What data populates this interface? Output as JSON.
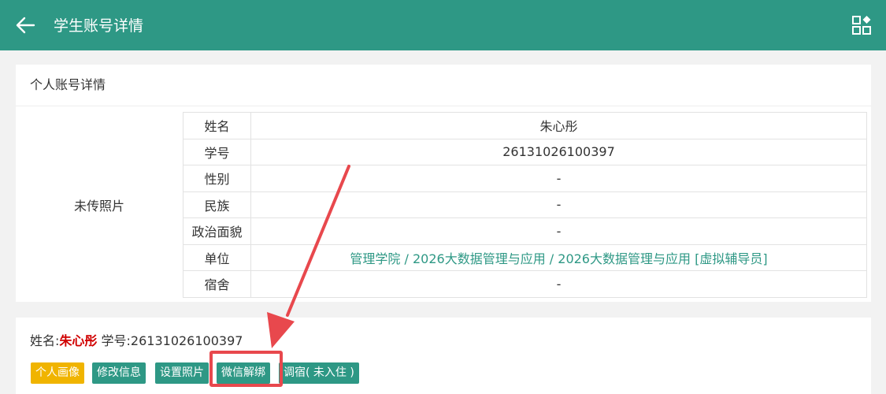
{
  "header": {
    "title": "学生账号详情",
    "back_icon": "arrow-left-icon",
    "apps_icon": "apps-grid-icon"
  },
  "detail_card": {
    "title": "个人账号详情",
    "photo_placeholder": "未传照片",
    "rows": [
      {
        "label": "姓名",
        "value": "朱心彤"
      },
      {
        "label": "学号",
        "value": "26131026100397"
      },
      {
        "label": "性别",
        "value": "-"
      },
      {
        "label": "民族",
        "value": "-"
      },
      {
        "label": "政治面貌",
        "value": "-"
      },
      {
        "label": "单位",
        "value": "管理学院 / 2026大数据管理与应用 / 2026大数据管理与应用 [虚拟辅导员]"
      },
      {
        "label": "宿舍",
        "value": "-"
      }
    ]
  },
  "summary_card": {
    "name_label": "姓名:",
    "name_value": "朱心彤",
    "id_label": "学号:",
    "id_value": "26131026100397",
    "buttons": {
      "portrait": "个人画像",
      "edit_info": "修改信息",
      "set_photo": "设置照片",
      "wechat_unbind": "微信解绑",
      "dorm": "调宿( 未入住 )"
    }
  },
  "colors": {
    "primary": "#2e9885",
    "warning": "#f0b400",
    "name_highlight": "#d00000",
    "annotation": "#e8484d"
  }
}
